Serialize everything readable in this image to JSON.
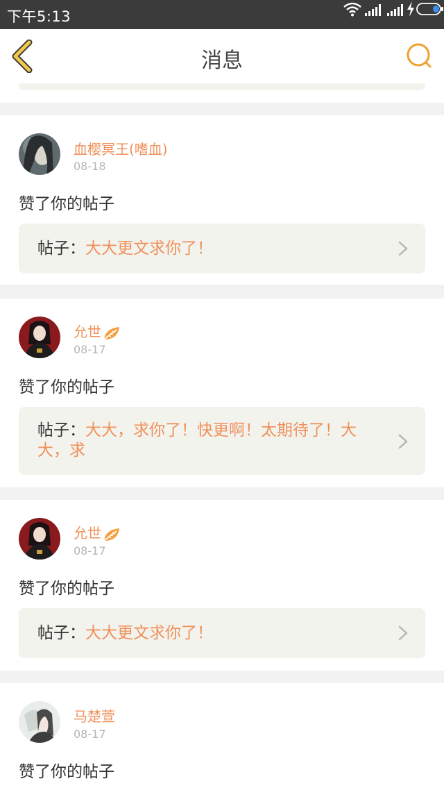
{
  "status_bar": {
    "time": "下午5:13"
  },
  "nav": {
    "title": "消息",
    "back_icon": "back-chevron-icon",
    "search_icon": "search-icon",
    "accent": "#f0a030"
  },
  "colors": {
    "highlight": "#f0905a",
    "card_bg": "#f3f3ee",
    "page_bg": "#f2f2f2"
  },
  "messages": [
    {
      "user": "血樱冥王(嗜血)",
      "date": "08-18",
      "action": "赞了你的帖子",
      "post_label": "帖子：",
      "post_title": "大大更文求你了！",
      "badge": ""
    },
    {
      "user": "允世",
      "date": "08-17",
      "action": "赞了你的帖子",
      "post_label": "帖子：",
      "post_title": "大大，求你了！快更啊！太期待了！大大，求",
      "badge": "leaf-badge-icon"
    },
    {
      "user": "允世",
      "date": "08-17",
      "action": "赞了你的帖子",
      "post_label": "帖子：",
      "post_title": "大大更文求你了！",
      "badge": "leaf-badge-icon"
    },
    {
      "user": "马楚萱",
      "date": "08-17",
      "action": "赞了你的帖子",
      "post_label": "",
      "post_title": "",
      "badge": ""
    }
  ]
}
